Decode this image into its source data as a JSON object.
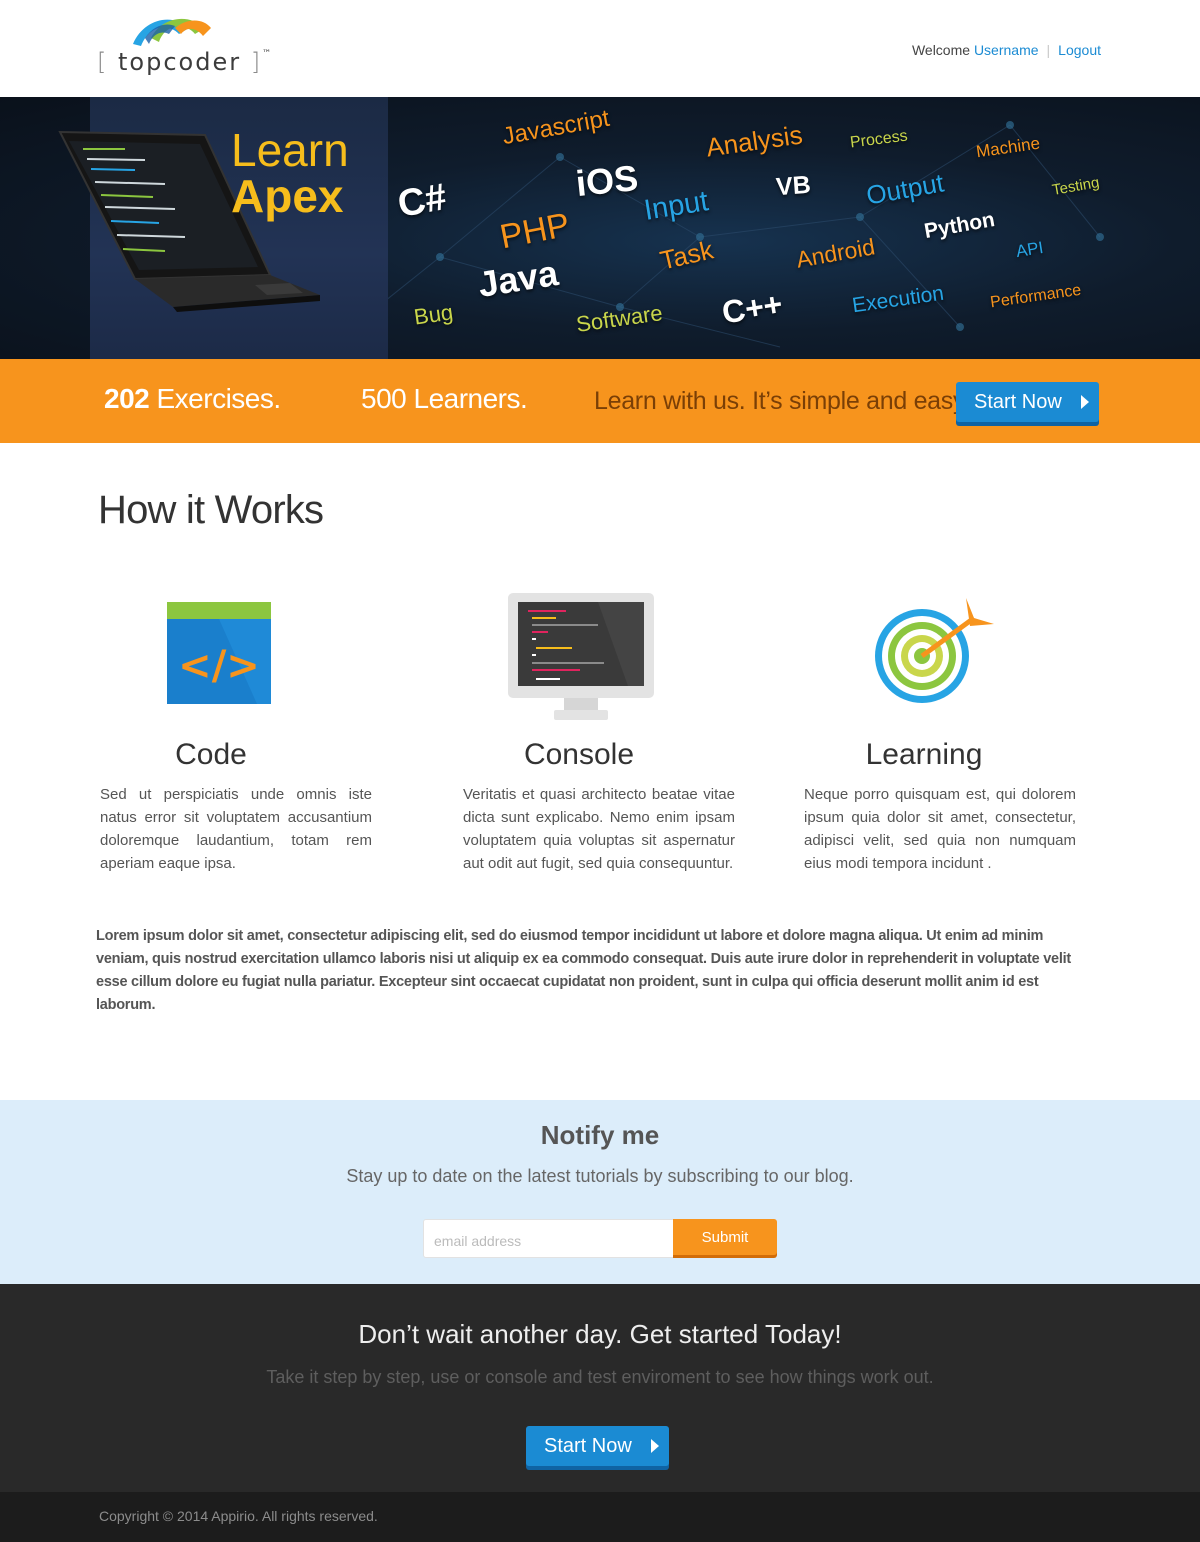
{
  "header": {
    "logo_text": "topcoder",
    "logo_tm": "™",
    "welcome": "Welcome",
    "username": "Username",
    "logout": "Logout"
  },
  "hero": {
    "title_line1": "Learn",
    "title_line2": "Apex",
    "words": [
      {
        "text": "Javascript",
        "color": "#f7941d"
      },
      {
        "text": "Analysis",
        "color": "#f7941d"
      },
      {
        "text": "Process",
        "color": "#c9d64b"
      },
      {
        "text": "Machine",
        "color": "#f7941d"
      },
      {
        "text": "Testing",
        "color": "#c9d64b"
      },
      {
        "text": "C#",
        "color": "#ffffff"
      },
      {
        "text": "iOS",
        "color": "#ffffff"
      },
      {
        "text": "VB",
        "color": "#ffffff"
      },
      {
        "text": "Output",
        "color": "#27a4e4"
      },
      {
        "text": "Input",
        "color": "#27a4e4"
      },
      {
        "text": "PHP",
        "color": "#f7941d"
      },
      {
        "text": "Python",
        "color": "#ffffff"
      },
      {
        "text": "Task",
        "color": "#f7941d"
      },
      {
        "text": "API",
        "color": "#27a4e4"
      },
      {
        "text": "Android",
        "color": "#f7941d"
      },
      {
        "text": "Java",
        "color": "#ffffff"
      },
      {
        "text": "C++",
        "color": "#ffffff"
      },
      {
        "text": "Execution",
        "color": "#27a4e4"
      },
      {
        "text": "Performance",
        "color": "#f7941d"
      },
      {
        "text": "Bug",
        "color": "#c9d64b"
      },
      {
        "text": "Software",
        "color": "#c9d64b"
      }
    ]
  },
  "stats": {
    "exercises_count": "202",
    "exercises_label": "Exercises.",
    "learners": "500 Learners.",
    "tagline": "Learn with us. It’s simple and easy.",
    "start_button": "Start Now"
  },
  "how_it_works": {
    "title": "How it Works",
    "features": [
      {
        "title": "Code",
        "icon": "code-icon",
        "text": "Sed ut perspiciatis unde omnis iste natus error sit voluptatem accusantium doloremque laudantium, totam rem aperiam eaque ipsa."
      },
      {
        "title": "Console",
        "icon": "monitor-icon",
        "text": "Veritatis et quasi architecto beatae vitae dicta sunt explicabo. Nemo enim ipsam voluptatem quia voluptas sit aspernatur aut odit aut fugit, sed quia consequuntur."
      },
      {
        "title": "Learning",
        "icon": "target-icon",
        "text": "Neque porro quisquam est, qui dolorem ipsum quia dolor sit amet, consectetur, adipisci velit, sed quia non numquam eius modi tempora incidunt ."
      }
    ],
    "paragraph": "Lorem ipsum dolor sit amet, consectetur adipiscing elit, sed do eiusmod tempor incididunt ut labore et dolore magna aliqua. Ut enim ad minim veniam, quis nostrud exercitation ullamco laboris nisi ut aliquip ex ea commodo consequat. Duis aute irure dolor in reprehenderit in voluptate velit esse cillum dolore eu fugiat nulla pariatur. Excepteur sint occaecat cupidatat non proident, sunt in culpa qui officia deserunt mollit anim id est laborum."
  },
  "notify": {
    "title": "Notify me",
    "subtitle": "Stay up to date on the latest tutorials by subscribing to our blog.",
    "email_placeholder": "email address",
    "submit": "Submit"
  },
  "cta": {
    "title": "Don’t wait another day. Get started Today!",
    "subtitle": "Take it step by step, use or console and test enviroment to see how things work out.",
    "button": "Start Now"
  },
  "footer": {
    "copyright": "Copyright © 2014 Appirio. All rights reserved."
  },
  "colors": {
    "accent_orange": "#f7941d",
    "accent_blue": "#1b8bd3",
    "notify_bg": "#dcedfa",
    "cta_bg": "#292929",
    "hero_title": "#f6bd1c"
  }
}
